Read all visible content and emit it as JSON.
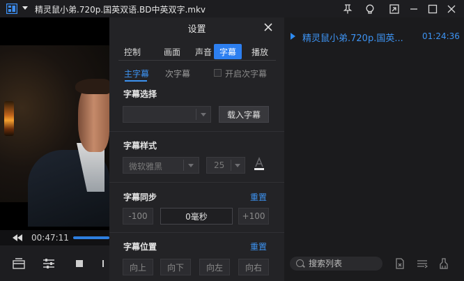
{
  "window": {
    "title": "精灵鼠小弟.720p.国英双语.BD中英双字.mkv",
    "icons": [
      "app-logo-icon",
      "menu-caret-icon",
      "pin-icon",
      "skin-icon",
      "mini-mode-icon",
      "minimize-icon",
      "maximize-icon",
      "close-icon"
    ]
  },
  "player": {
    "current_time": "00:47:11",
    "progress_fraction": 0.58
  },
  "playlist": {
    "items": [
      {
        "name": "精灵鼠小弟.720p.国英...",
        "duration": "01:24:36"
      }
    ],
    "search_placeholder": "搜索列表"
  },
  "settings": {
    "title": "设置",
    "tabs": [
      "控制",
      "画面",
      "声音",
      "字幕",
      "播放"
    ],
    "active_tab": "字幕",
    "subtabs": {
      "primary": "主字幕",
      "secondary": "次字幕",
      "enable_secondary": "开启次字幕"
    },
    "subtitle_select": {
      "title": "字幕选择",
      "value": "",
      "load_button": "载入字幕"
    },
    "subtitle_style": {
      "title": "字幕样式",
      "font": "微软雅黑",
      "size": "25"
    },
    "subtitle_sync": {
      "title": "字幕同步",
      "reset": "重置",
      "minus": "-100",
      "value": "0毫秒",
      "plus": "+100"
    },
    "subtitle_position": {
      "title": "字幕位置",
      "reset": "重置",
      "up": "向上",
      "down": "向下",
      "left": "向左",
      "right": "向右"
    }
  },
  "colors": {
    "accent": "#2d7ff0",
    "link": "#3d93f2",
    "dialog_bg": "#232326",
    "window_bg": "#1b1b1d"
  }
}
